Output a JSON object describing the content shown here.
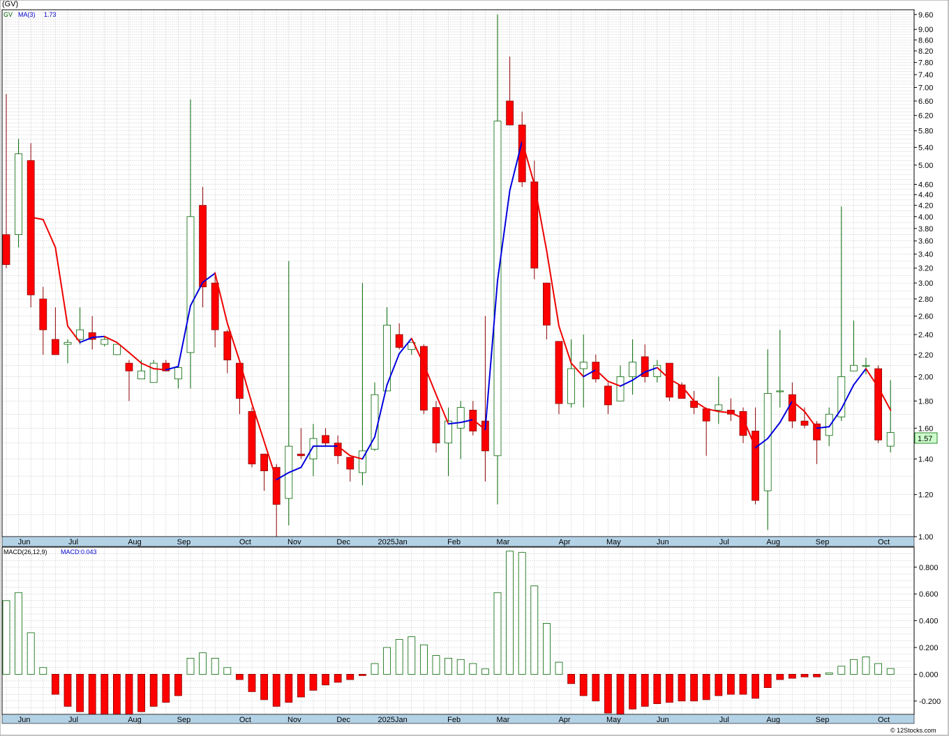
{
  "header": {
    "symbol_label": "(GV)"
  },
  "footer": {
    "copyright": "© 12Stocks.com"
  },
  "colors": {
    "background": "#ffffff",
    "plot_background": "#ffffff",
    "grid": "#c8c8c8",
    "axis_band": "#b4d2e6",
    "up_body": "#ffffff",
    "up_border": "#006400",
    "down_body": "#ff0000",
    "down_border": "#8b0000",
    "ma_up": "#0000dd",
    "ma_down": "#ee0000",
    "price_badge": "#ccffcc"
  },
  "chart_data": [
    {
      "type": "candlestick",
      "legend": {
        "symbol": "GV",
        "ma_label": "MA(3)",
        "ma_value": "1.73"
      },
      "last_price_label": "1.57",
      "y_scale": "log",
      "ylim": [
        1.0,
        9.8
      ],
      "y_ticks": [
        "9.60",
        "9.00",
        "8.60",
        "8.20",
        "7.80",
        "7.40",
        "7.00",
        "6.60",
        "6.20",
        "5.80",
        "5.40",
        "5.00",
        "4.60",
        "4.40",
        "4.20",
        "4.00",
        "3.80",
        "3.60",
        "3.40",
        "3.20",
        "3.00",
        "2.80",
        "2.60",
        "2.40",
        "2.20",
        "2.00",
        "1.80",
        "1.60",
        "1.40",
        "1.20",
        "1.00"
      ],
      "x_labels": [
        {
          "label": "Jun",
          "week": 1
        },
        {
          "label": "Jul",
          "week": 5
        },
        {
          "label": "Aug",
          "week": 10
        },
        {
          "label": "Sep",
          "week": 14
        },
        {
          "label": "Oct",
          "week": 19
        },
        {
          "label": "Nov",
          "week": 23
        },
        {
          "label": "Dec",
          "week": 27
        },
        {
          "label": "2025Jan",
          "week": 31
        },
        {
          "label": "Feb",
          "week": 36
        },
        {
          "label": "Mar",
          "week": 40
        },
        {
          "label": "Apr",
          "week": 45
        },
        {
          "label": "May",
          "week": 49
        },
        {
          "label": "Jun",
          "week": 53
        },
        {
          "label": "Jul",
          "week": 58
        },
        {
          "label": "Aug",
          "week": 62
        },
        {
          "label": "Sep",
          "week": 66
        },
        {
          "label": "Oct",
          "week": 71
        }
      ],
      "candles": [
        [
          3.7,
          6.8,
          3.2,
          3.25
        ],
        [
          3.7,
          5.6,
          3.5,
          5.25
        ],
        [
          5.1,
          5.5,
          2.7,
          2.85
        ],
        [
          2.8,
          2.95,
          2.2,
          2.45
        ],
        [
          2.35,
          2.7,
          2.2,
          2.2
        ],
        [
          2.3,
          2.35,
          2.12,
          2.32
        ],
        [
          2.35,
          2.7,
          2.3,
          2.45
        ],
        [
          2.42,
          2.6,
          2.25,
          2.35
        ],
        [
          2.3,
          2.38,
          2.28,
          2.35
        ],
        [
          2.2,
          2.3,
          2.2,
          2.3
        ],
        [
          2.12,
          2.15,
          1.8,
          2.05
        ],
        [
          1.98,
          2.15,
          1.98,
          2.05
        ],
        [
          1.95,
          2.15,
          1.95,
          2.12
        ],
        [
          2.12,
          2.15,
          2.05,
          2.05
        ],
        [
          1.98,
          2.1,
          1.9,
          2.08
        ],
        [
          2.22,
          6.65,
          1.9,
          4.0
        ],
        [
          4.2,
          4.55,
          2.7,
          2.95
        ],
        [
          3.0,
          3.15,
          2.27,
          2.45
        ],
        [
          2.43,
          2.45,
          2.03,
          2.15
        ],
        [
          2.12,
          2.15,
          1.7,
          1.82
        ],
        [
          1.72,
          1.75,
          1.35,
          1.37
        ],
        [
          1.43,
          1.43,
          1.22,
          1.33
        ],
        [
          1.35,
          1.37,
          1.0,
          1.15
        ],
        [
          1.18,
          3.3,
          1.05,
          1.48
        ],
        [
          1.43,
          1.6,
          1.4,
          1.42
        ],
        [
          1.4,
          1.63,
          1.3,
          1.53
        ],
        [
          1.55,
          1.6,
          1.48,
          1.5
        ],
        [
          1.5,
          1.55,
          1.37,
          1.42
        ],
        [
          1.41,
          1.41,
          1.27,
          1.34
        ],
        [
          1.32,
          3.0,
          1.25,
          1.45
        ],
        [
          1.46,
          1.95,
          1.45,
          1.85
        ],
        [
          1.88,
          2.7,
          1.88,
          2.5
        ],
        [
          2.4,
          2.52,
          2.25,
          2.27
        ],
        [
          2.25,
          2.3,
          2.2,
          2.32
        ],
        [
          2.28,
          2.3,
          1.7,
          1.73
        ],
        [
          1.75,
          1.8,
          1.44,
          1.5
        ],
        [
          1.5,
          1.75,
          1.3,
          1.65
        ],
        [
          1.6,
          1.8,
          1.4,
          1.75
        ],
        [
          1.73,
          1.8,
          1.55,
          1.58
        ],
        [
          1.65,
          2.6,
          1.27,
          1.45
        ],
        [
          1.42,
          9.6,
          1.15,
          6.05
        ],
        [
          6.6,
          8.0,
          5.95,
          5.95
        ],
        [
          5.95,
          6.3,
          4.55,
          4.65
        ],
        [
          4.65,
          5.1,
          3.05,
          3.2
        ],
        [
          3.0,
          3.0,
          2.35,
          2.5
        ],
        [
          2.33,
          2.33,
          1.7,
          1.78
        ],
        [
          1.78,
          2.35,
          1.75,
          2.07
        ],
        [
          2.07,
          2.4,
          1.75,
          2.13
        ],
        [
          2.13,
          2.2,
          1.95,
          1.98
        ],
        [
          1.92,
          1.95,
          1.7,
          1.77
        ],
        [
          1.8,
          2.1,
          1.8,
          2.0
        ],
        [
          2.0,
          2.35,
          1.85,
          2.13
        ],
        [
          2.18,
          2.3,
          1.95,
          2.0
        ],
        [
          2.0,
          2.15,
          1.95,
          2.1
        ],
        [
          2.12,
          2.12,
          1.8,
          1.83
        ],
        [
          1.93,
          1.95,
          1.82,
          1.82
        ],
        [
          1.8,
          1.88,
          1.7,
          1.75
        ],
        [
          1.74,
          1.75,
          1.42,
          1.65
        ],
        [
          1.73,
          2.0,
          1.63,
          1.77
        ],
        [
          1.73,
          1.82,
          1.65,
          1.7
        ],
        [
          1.72,
          1.75,
          1.5,
          1.55
        ],
        [
          1.58,
          1.75,
          1.15,
          1.17
        ],
        [
          1.22,
          2.25,
          1.03,
          1.86
        ],
        [
          1.88,
          2.45,
          1.75,
          1.88
        ],
        [
          1.85,
          1.95,
          1.6,
          1.65
        ],
        [
          1.65,
          1.75,
          1.6,
          1.62
        ],
        [
          1.63,
          1.65,
          1.37,
          1.52
        ],
        [
          1.55,
          1.75,
          1.48,
          1.7
        ],
        [
          1.68,
          4.18,
          1.65,
          2.0
        ],
        [
          2.05,
          2.55,
          2.05,
          2.1
        ],
        [
          2.1,
          2.17,
          2.02,
          2.1
        ],
        [
          2.07,
          2.1,
          1.5,
          1.52
        ],
        [
          1.48,
          1.97,
          1.44,
          1.57
        ]
      ],
      "ma3": [
        null,
        null,
        3.99,
        3.95,
        3.5,
        2.49,
        2.32,
        2.37,
        2.38,
        2.32,
        2.22,
        2.12,
        2.07,
        2.06,
        2.09,
        2.72,
        3.01,
        3.13,
        2.52,
        2.14,
        1.78,
        1.51,
        1.28,
        1.32,
        1.35,
        1.48,
        1.48,
        1.48,
        1.42,
        1.4,
        1.54,
        1.93,
        2.21,
        2.36,
        2.11,
        1.85,
        1.63,
        1.64,
        1.66,
        1.59,
        3.03,
        4.48,
        5.55,
        4.6,
        3.45,
        2.49,
        2.12,
        2.0,
        2.06,
        1.96,
        1.92,
        1.97,
        2.04,
        2.08,
        1.98,
        1.92,
        1.8,
        1.74,
        1.72,
        1.71,
        1.67,
        1.47,
        1.53,
        1.64,
        1.8,
        1.72,
        1.6,
        1.61,
        1.74,
        1.93,
        2.07,
        1.91,
        1.73
      ]
    },
    {
      "type": "bar",
      "legend": {
        "label": "MACD(26,12,9)",
        "value_label": "MACD:0.043"
      },
      "ylim": [
        -0.3,
        0.95
      ],
      "y_ticks": [
        "0.800",
        "0.600",
        "0.400",
        "0.200",
        "0.000",
        "-0.200"
      ],
      "x_labels": [
        {
          "label": "Jun",
          "week": 1
        },
        {
          "label": "Jul",
          "week": 5
        },
        {
          "label": "Aug",
          "week": 10
        },
        {
          "label": "Sep",
          "week": 14
        },
        {
          "label": "Oct",
          "week": 19
        },
        {
          "label": "Nov",
          "week": 23
        },
        {
          "label": "Dec",
          "week": 27
        },
        {
          "label": "2025Jan",
          "week": 31
        },
        {
          "label": "Feb",
          "week": 36
        },
        {
          "label": "Mar",
          "week": 40
        },
        {
          "label": "Apr",
          "week": 45
        },
        {
          "label": "May",
          "week": 49
        },
        {
          "label": "Jun",
          "week": 53
        },
        {
          "label": "Jul",
          "week": 58
        },
        {
          "label": "Aug",
          "week": 62
        },
        {
          "label": "Sep",
          "week": 66
        },
        {
          "label": "Oct",
          "week": 71
        }
      ],
      "values": [
        0.55,
        0.61,
        0.31,
        0.05,
        -0.15,
        -0.24,
        -0.28,
        -0.3,
        -0.3,
        -0.31,
        -0.3,
        -0.28,
        -0.24,
        -0.21,
        -0.16,
        0.12,
        0.16,
        0.12,
        0.05,
        -0.04,
        -0.13,
        -0.19,
        -0.24,
        -0.21,
        -0.17,
        -0.12,
        -0.08,
        -0.06,
        -0.04,
        -0.01,
        0.08,
        0.2,
        0.26,
        0.28,
        0.22,
        0.14,
        0.12,
        0.11,
        0.08,
        0.04,
        0.61,
        0.92,
        0.91,
        0.66,
        0.38,
        0.09,
        -0.07,
        -0.16,
        -0.2,
        -0.29,
        -0.3,
        -0.26,
        -0.24,
        -0.22,
        -0.21,
        -0.2,
        -0.2,
        -0.19,
        -0.16,
        -0.15,
        -0.15,
        -0.18,
        -0.1,
        -0.04,
        -0.03,
        -0.02,
        -0.02,
        0.01,
        0.06,
        0.11,
        0.13,
        0.08,
        0.043
      ]
    }
  ]
}
